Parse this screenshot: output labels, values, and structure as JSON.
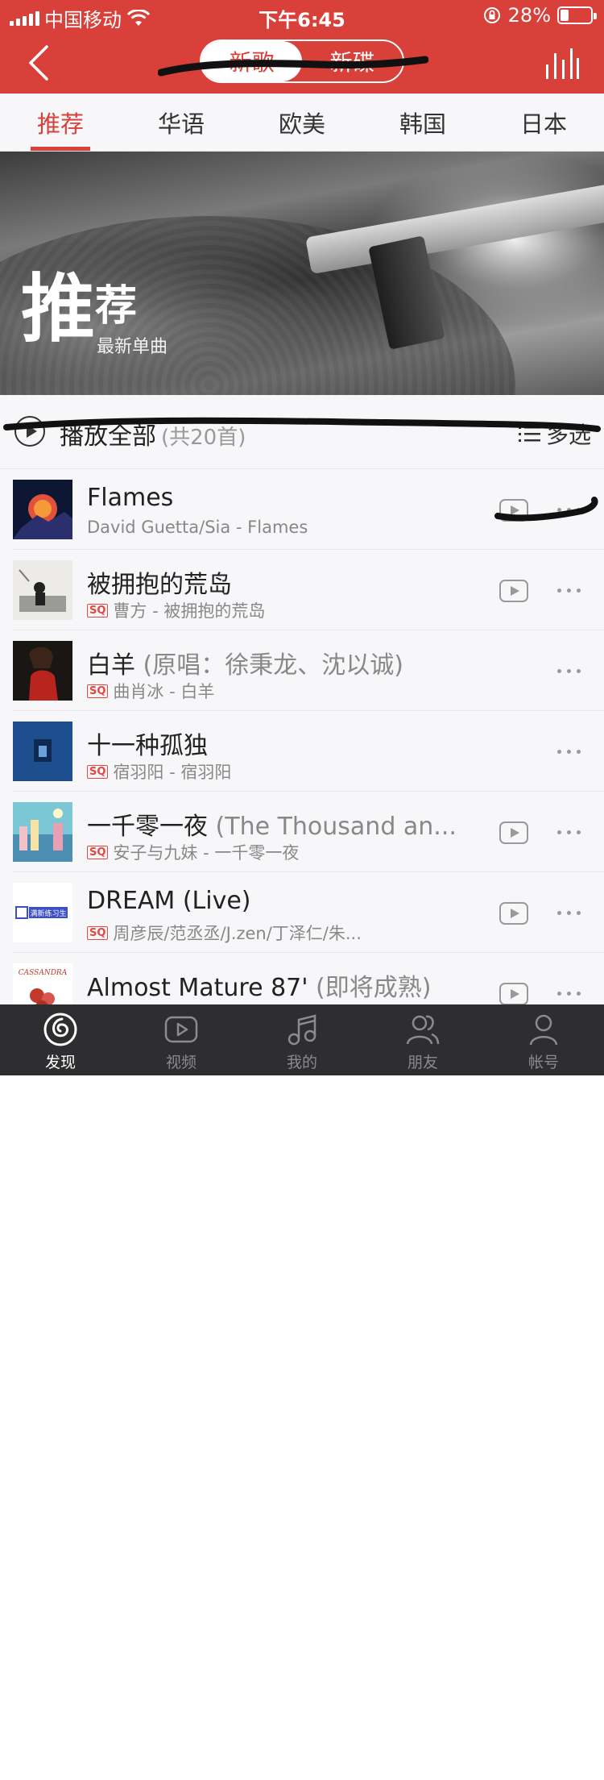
{
  "status_bar": {
    "carrier": "中国移动",
    "time": "下午6:45",
    "battery": "28%"
  },
  "nav": {
    "segments": [
      {
        "label": "新歌",
        "active": true
      },
      {
        "label": "新碟",
        "active": false
      }
    ]
  },
  "tabs": [
    {
      "label": "推荐",
      "active": true
    },
    {
      "label": "华语",
      "active": false
    },
    {
      "label": "欧美",
      "active": false
    },
    {
      "label": "韩国",
      "active": false
    },
    {
      "label": "日本",
      "active": false
    }
  ],
  "banner": {
    "title_big": "推",
    "title_small": "荐",
    "subtitle": "最新单曲"
  },
  "play_all": {
    "label": "播放全部",
    "count": "(共20首)",
    "multi_select": "多选"
  },
  "songs": [
    {
      "title": "Flames",
      "title_alt": "",
      "artist": "David Guetta/Sia - Flames",
      "sq": false,
      "mv": true
    },
    {
      "title": "被拥抱的荒岛",
      "title_alt": "",
      "artist": "曹方 - 被拥抱的荒岛",
      "sq": true,
      "mv": true
    },
    {
      "title": "白羊",
      "title_alt": "(原唱：徐秉龙、沈以诚)",
      "artist": "曲肖冰 - 白羊",
      "sq": true,
      "mv": false
    },
    {
      "title": "十一种孤独",
      "title_alt": "",
      "artist": "宿羽阳 - 宿羽阳",
      "sq": true,
      "mv": false
    },
    {
      "title": "一千零一夜",
      "title_alt": "(The Thousand an...",
      "artist": "安子与九妹 - 一千零一夜",
      "sq": true,
      "mv": true
    },
    {
      "title": "DREAM (Live)",
      "title_alt": "",
      "artist": "周彦辰/范丞丞/J.zen/丁泽仁/朱...",
      "sq": true,
      "mv": true
    },
    {
      "title": "Almost Mature 87'",
      "title_alt": "(即将成熟)",
      "artist": "",
      "sq": false,
      "mv": true
    }
  ],
  "cover_texts": {
    "cover_6": "满新练习生",
    "cover_7": "CASSANDRA"
  },
  "tab_bar": [
    {
      "label": "发现",
      "icon": "discover-icon",
      "active": true
    },
    {
      "label": "视频",
      "icon": "video-icon",
      "active": false
    },
    {
      "label": "我的",
      "icon": "music-note-icon",
      "active": false
    },
    {
      "label": "朋友",
      "icon": "friends-icon",
      "active": false
    },
    {
      "label": "帐号",
      "icon": "account-icon",
      "active": false
    }
  ],
  "colors": {
    "brand_red": "#d9403a",
    "tab_bar_bg": "#2e2e30"
  }
}
